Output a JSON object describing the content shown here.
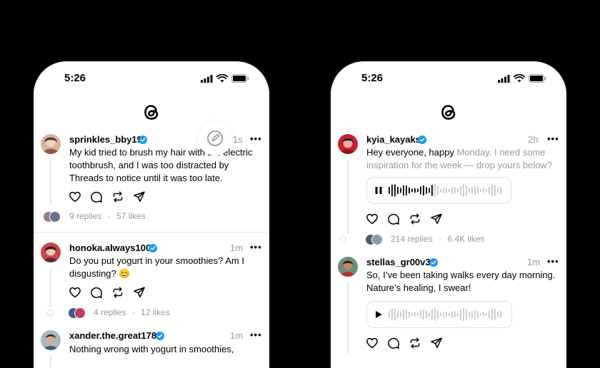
{
  "status_time": "5:26",
  "icons": {
    "signal": "signal-icon",
    "wifi": "wifi-icon",
    "battery": "battery-icon",
    "logo": "threads-logo-icon",
    "compose": "compose-icon",
    "like": "heart-icon",
    "reply": "comment-icon",
    "repost": "repost-icon",
    "share": "send-icon",
    "more": "more-icon",
    "verified": "verified-badge-icon",
    "pause": "pause-icon",
    "play": "play-icon"
  },
  "colors": {
    "verified": "#1d9bf0",
    "muted": "#999999"
  },
  "left_feed": {
    "posts": [
      {
        "username": "sprinkles_bby19",
        "time": "1s",
        "more": "•••",
        "lines": [
          "My kid tried to brush my hair with the electric",
          "toothbrush, and I was too distracted by",
          "Threads to notice until it was too late."
        ],
        "replies": "9 replies",
        "likes": "57 likes"
      },
      {
        "username": "honoka.always100",
        "time": "1m",
        "more": "•••",
        "lines": [
          "Do you put yogurt in your smoothies? Am I",
          "disgusting? 😊"
        ],
        "replies": "4 replies",
        "likes": "12 likes"
      },
      {
        "username": "xander.the.great178",
        "time": "1m",
        "more": "•••",
        "lines": [
          "Nothing wrong with yogurt in smoothies,"
        ]
      }
    ]
  },
  "right_feed": {
    "posts": [
      {
        "username": "kyia_kayaks",
        "time": "2h",
        "more": "•••",
        "line1_dark": "Hey everyone, happy ",
        "line1_muted": "Monday. I need some",
        "line2_muted": "inspiration for the week — drop yours below?",
        "replies": "214 replies",
        "likes": "6.4K likes"
      },
      {
        "username": "stellas_gr00v3",
        "time": "1m",
        "more": "•••",
        "lines": [
          "So, I’ve been taking walks every day morning.",
          "Nature’s healing, I swear!"
        ]
      }
    ]
  },
  "separator": "·"
}
